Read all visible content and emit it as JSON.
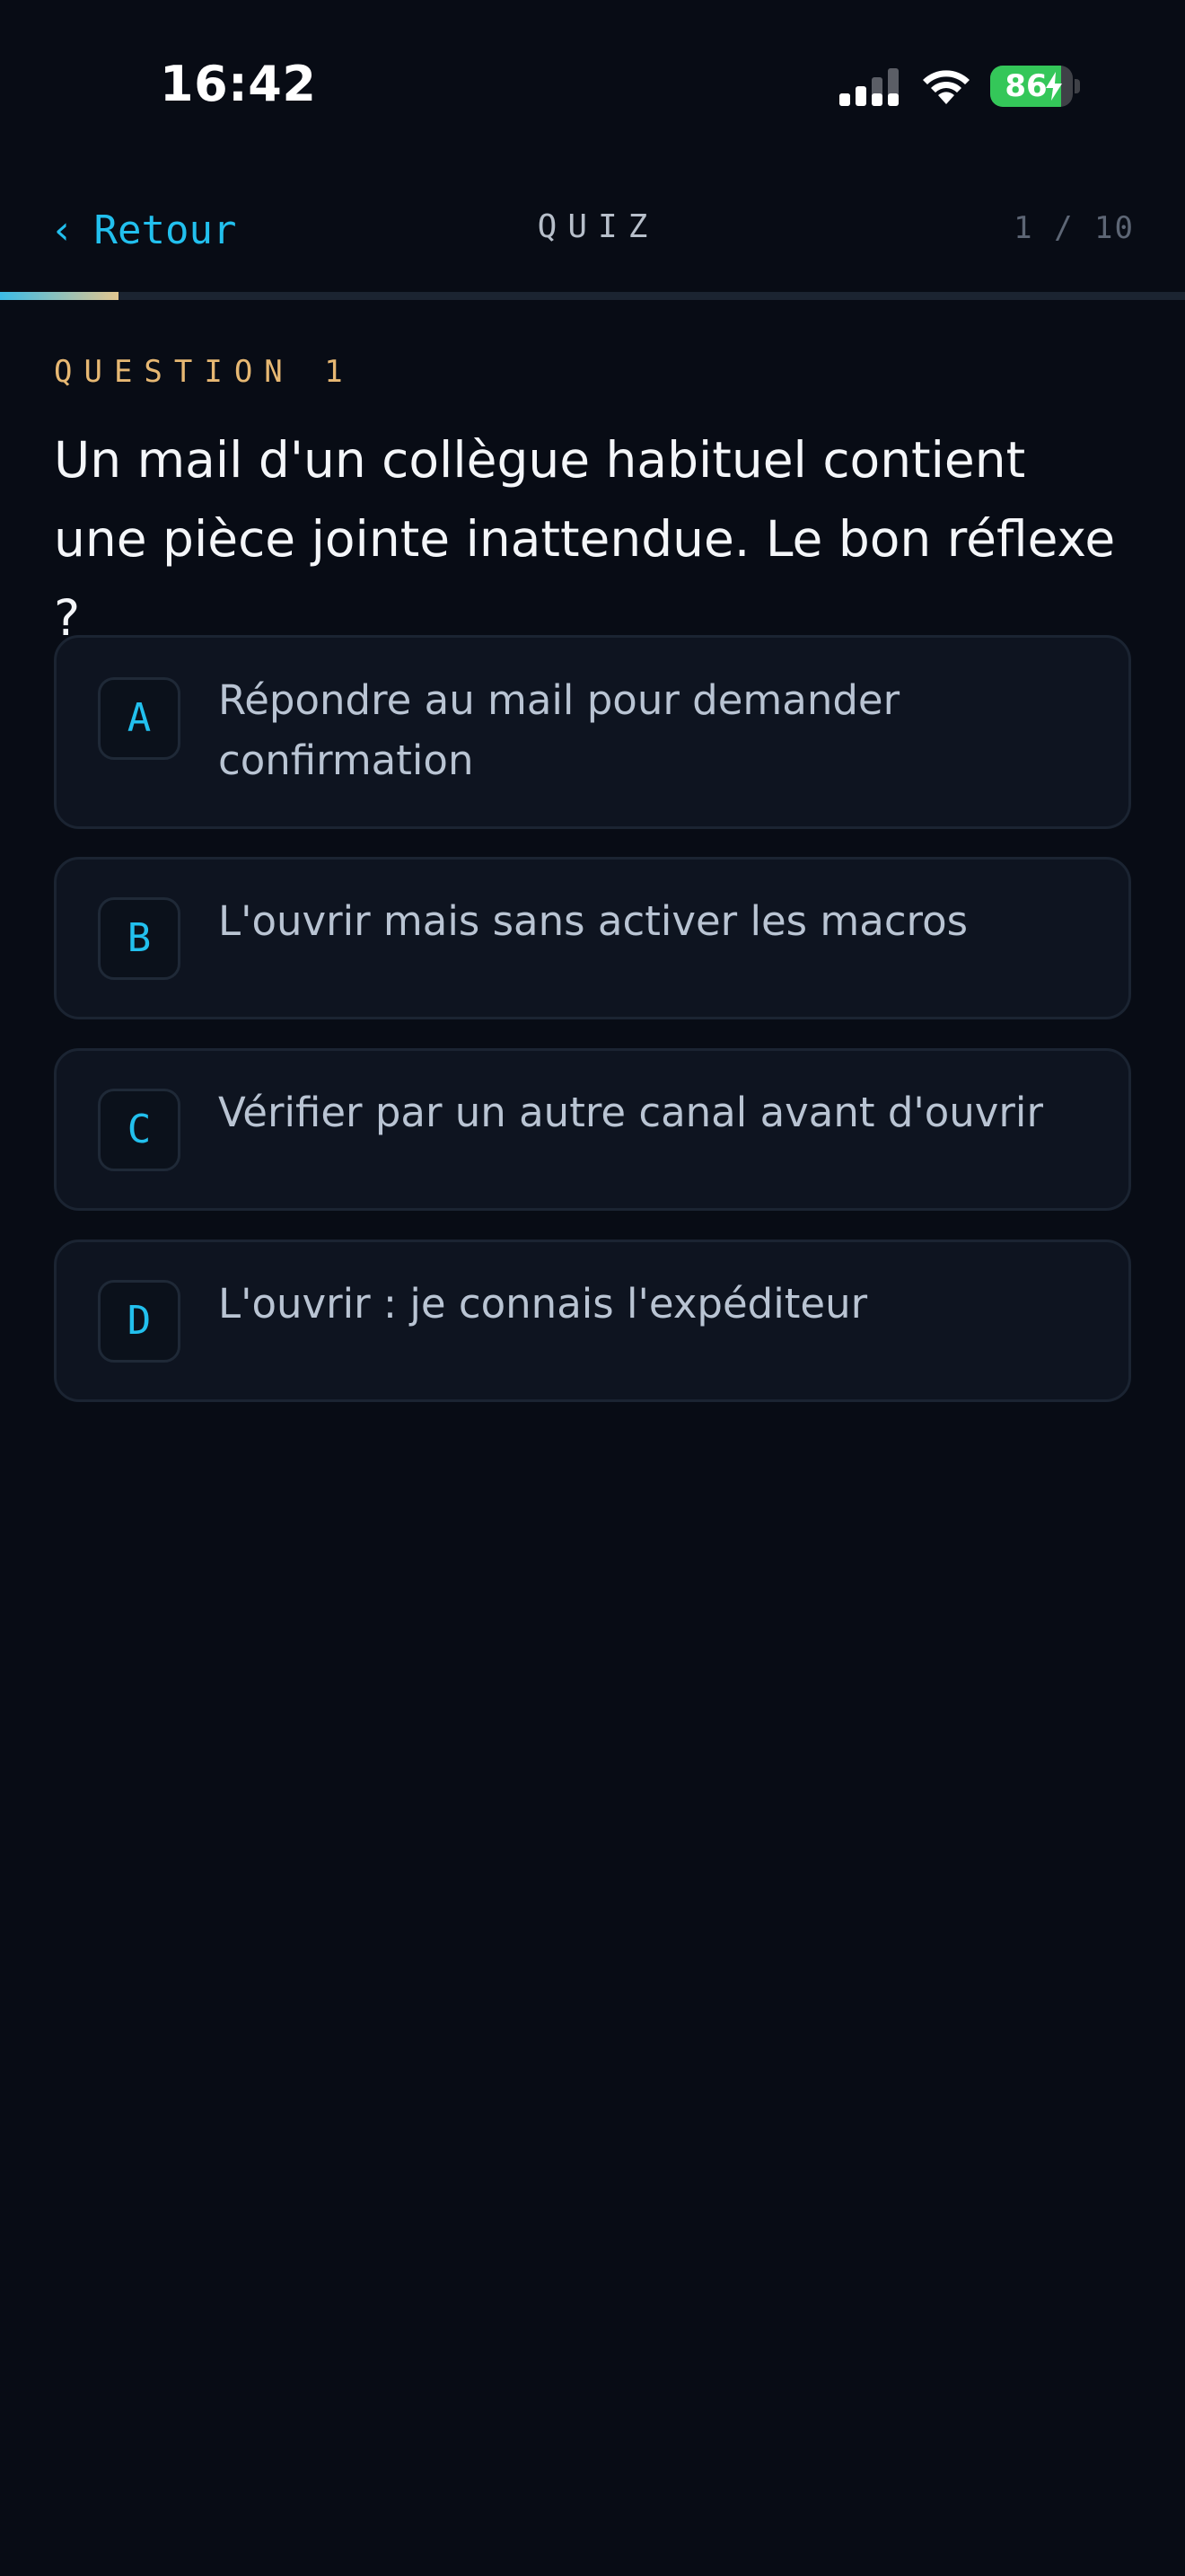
{
  "status_bar": {
    "time": "16:42",
    "battery_percent": "86",
    "battery_level": 0.86,
    "charging": true,
    "icons": [
      "signal-icon",
      "wifi-icon",
      "battery-icon",
      "bolt-icon"
    ]
  },
  "header": {
    "back_label": "Retour",
    "back_icon": "chevron-left-icon",
    "title": "QUIZ",
    "counter": "1 / 10"
  },
  "progress": {
    "fraction": 0.1,
    "gradient_start": "#3bbbe6",
    "gradient_end": "#e2c690"
  },
  "question": {
    "kicker": "QUESTION 1",
    "text": "Un mail d'un collègue habituel contient une pièce jointe inattendue. Le bon réflexe ?"
  },
  "answers": [
    {
      "letter": "A",
      "text": "Répondre au mail pour demander confirmation"
    },
    {
      "letter": "B",
      "text": "L'ouvrir mais sans activer les macros"
    },
    {
      "letter": "C",
      "text": "Vérifier par un autre canal avant d'ouvrir"
    },
    {
      "letter": "D",
      "text": "L'ouvrir : je connais l'expéditeur"
    }
  ],
  "colors": {
    "background": "#080c15",
    "accent": "#22c0ee",
    "kicker": "#e7b873",
    "card": "#0e1420",
    "battery_green": "#34c759"
  }
}
